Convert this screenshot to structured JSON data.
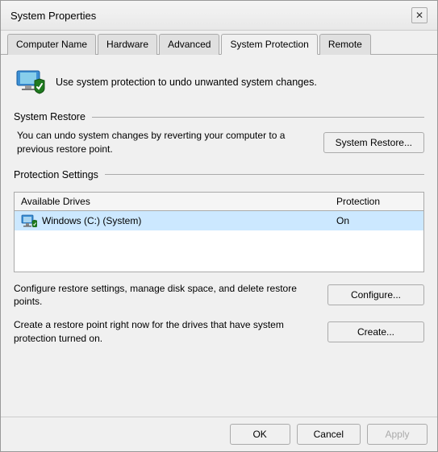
{
  "window": {
    "title": "System Properties",
    "close_label": "✕"
  },
  "tabs": [
    {
      "id": "computer-name",
      "label": "Computer Name",
      "active": false
    },
    {
      "id": "hardware",
      "label": "Hardware",
      "active": false
    },
    {
      "id": "advanced",
      "label": "Advanced",
      "active": false
    },
    {
      "id": "system-protection",
      "label": "System Protection",
      "active": true
    },
    {
      "id": "remote",
      "label": "Remote",
      "active": false
    }
  ],
  "info": {
    "text": "Use system protection to undo unwanted system changes."
  },
  "system_restore": {
    "label": "System Restore",
    "description": "You can undo system changes by reverting\nyour computer to a previous restore point.",
    "button": "System Restore..."
  },
  "protection_settings": {
    "label": "Protection Settings",
    "table": {
      "columns": [
        "Available Drives",
        "Protection"
      ],
      "rows": [
        {
          "drive": "Windows (C:) (System)",
          "protection": "On"
        }
      ]
    },
    "configure": {
      "description": "Configure restore settings, manage disk space, and\ndelete restore points.",
      "button": "Configure..."
    },
    "create": {
      "description": "Create a restore point right now for the drives that\nhave system protection turned on.",
      "button": "Create..."
    }
  },
  "footer": {
    "ok": "OK",
    "cancel": "Cancel",
    "apply": "Apply"
  }
}
